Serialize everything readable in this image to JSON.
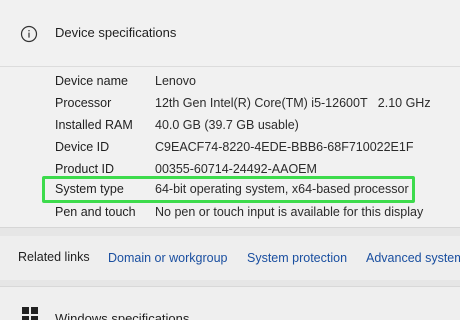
{
  "device_specs": {
    "title": "Device specifications",
    "rows": [
      {
        "label": "Device name",
        "value": "Lenovo"
      },
      {
        "label": "Processor",
        "value": "12th Gen Intel(R) Core(TM) i5-12600T   2.10 GHz"
      },
      {
        "label": "Installed RAM",
        "value": "40.0 GB (39.7 GB usable)"
      },
      {
        "label": "Device ID",
        "value": "C9EACF74-8220-4EDE-BBB6-68F710022E1F"
      },
      {
        "label": "Product ID",
        "value": "00355-60714-24492-AAOEM"
      },
      {
        "label": "System type",
        "value": "64-bit operating system, x64-based processor"
      },
      {
        "label": "Pen and touch",
        "value": "No pen or touch input is available for this display"
      }
    ]
  },
  "related": {
    "title": "Related links",
    "links": [
      "Domain or workgroup",
      "System protection",
      "Advanced system"
    ]
  },
  "windows_specs": {
    "title": "Windows specifications"
  },
  "colors": {
    "highlight": "#3ddb4c",
    "link": "#1a4fa0"
  },
  "icons": {
    "header": "info-icon",
    "windows": "windows-logo-icon"
  }
}
